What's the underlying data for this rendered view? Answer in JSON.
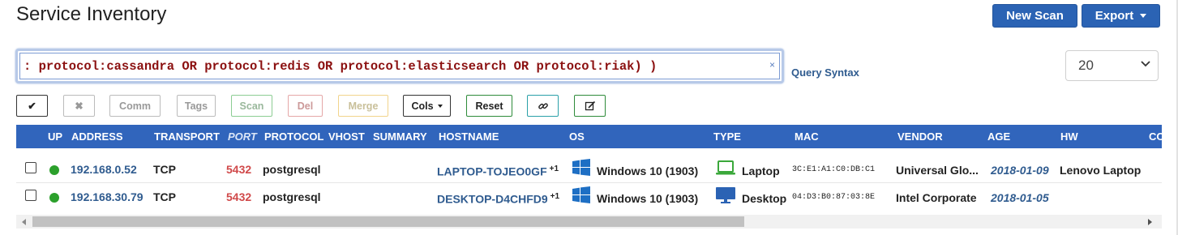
{
  "page": {
    "title": "Service Inventory"
  },
  "header_buttons": {
    "new_scan": "New Scan",
    "export": "Export"
  },
  "query": {
    "text": ": protocol:cassandra OR protocol:redis OR protocol:elasticsearch OR protocol:riak) )",
    "clear_glyph": "×",
    "syntax_link": "Query Syntax"
  },
  "per_page": {
    "value": "20"
  },
  "toolbar": {
    "check_glyph": "✔",
    "x_glyph": "✖",
    "comm": "Comm",
    "tags": "Tags",
    "scan": "Scan",
    "del": "Del",
    "merge": "Merge",
    "cols": "Cols",
    "reset": "Reset",
    "link_glyph": "🔗",
    "edit_glyph": "✎"
  },
  "table": {
    "headers": {
      "up": "UP",
      "address": "ADDRESS",
      "transport": "TRANSPORT",
      "port": "PORT",
      "protocol": "PROTOCOL",
      "vhost": "VHOST",
      "summary": "SUMMARY",
      "hostname": "HOSTNAME",
      "os": "OS",
      "type": "TYPE",
      "mac": "MAC",
      "vendor": "VENDOR",
      "age": "AGE",
      "hw": "HW",
      "extra": "CO"
    },
    "rows": [
      {
        "address": "192.168.0.52",
        "transport": "TCP",
        "port": "5432",
        "protocol": "postgresql",
        "hostname": "LAPTOP-TOJEO0GF",
        "host_extra": "+1",
        "os": "Windows 10 (1903)",
        "type": "Laptop",
        "type_icon": "laptop-icon",
        "mac": "3C:E1:A1:C0:DB:C1",
        "vendor": "Universal Glo...",
        "age": "2018-01-09",
        "hw": "Lenovo Laptop"
      },
      {
        "address": "192.168.30.79",
        "transport": "TCP",
        "port": "5432",
        "protocol": "postgresql",
        "hostname": "DESKTOP-D4CHFD9",
        "host_extra": "+1",
        "os": "Windows 10 (1903)",
        "type": "Desktop",
        "type_icon": "desktop-icon",
        "mac": "04:D3:B0:87:03:8E",
        "vendor": "Intel Corporate",
        "age": "2018-01-05",
        "hw": ""
      }
    ]
  },
  "colors": {
    "header_bg": "#3165bc",
    "primary": "#2b63b4",
    "up_green": "#2ca02c",
    "port_red": "#d0494a",
    "link_blue": "#2f5b8f"
  }
}
